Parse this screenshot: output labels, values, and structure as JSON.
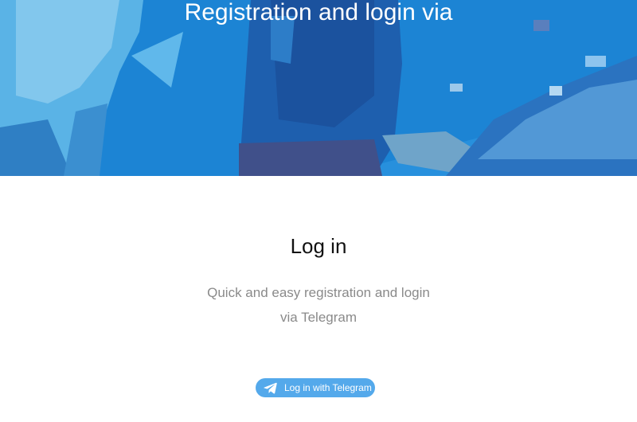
{
  "banner": {
    "title": "Registration and login via"
  },
  "login": {
    "title": "Log in",
    "description_line1": "Quick and easy registration and login",
    "description_line2": "via Telegram"
  },
  "telegram_button": {
    "label": "Log in with Telegram",
    "icon": "telegram-paper-plane-icon",
    "color": "#54a9eb"
  },
  "colors": {
    "banner_blue": "#1a86d6",
    "title_text": "#111111",
    "description_text": "#8a8a8a"
  }
}
